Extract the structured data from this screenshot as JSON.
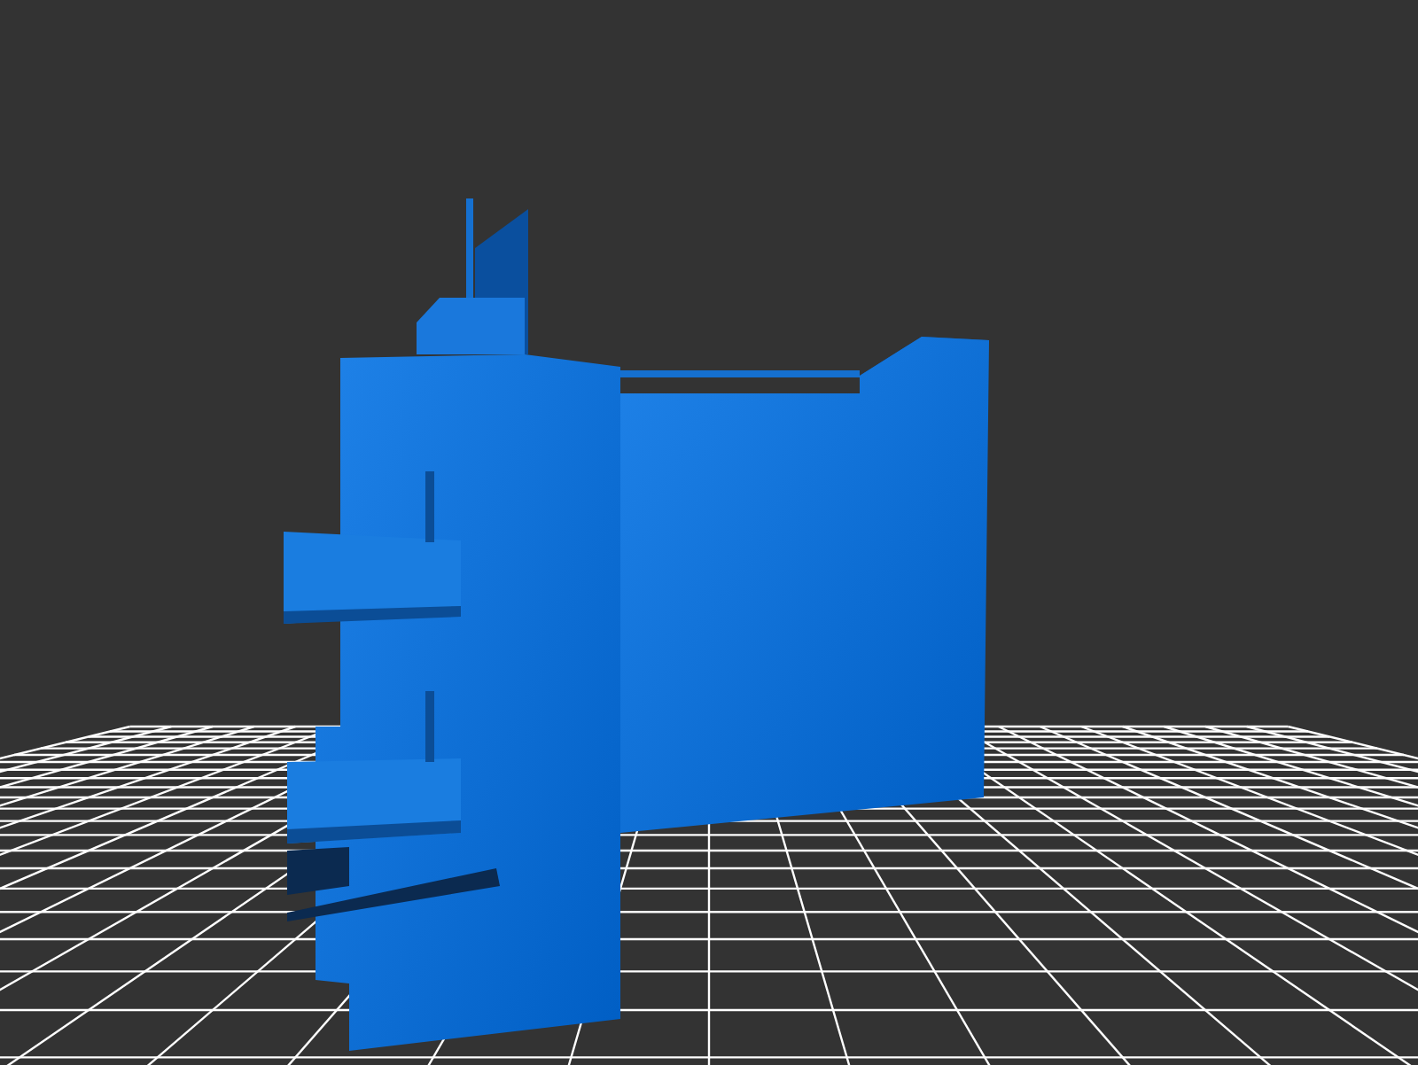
{
  "viewport": {
    "kind": "model"
  }
}
